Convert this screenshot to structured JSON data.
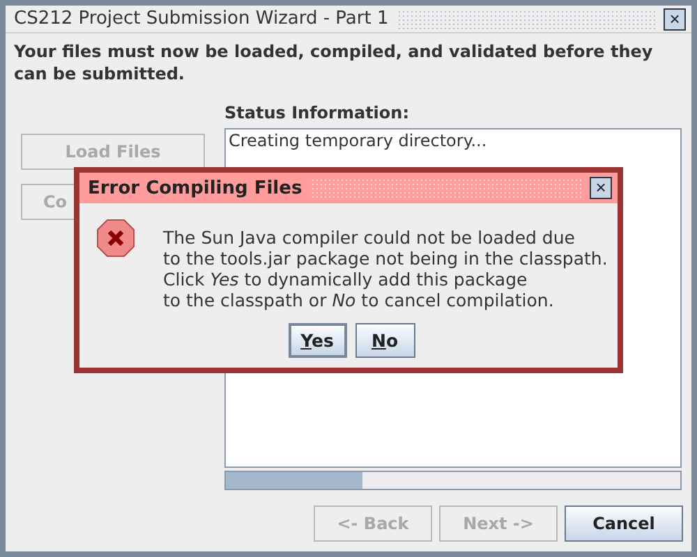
{
  "window": {
    "title": "CS212 Project Submission Wizard - Part 1",
    "close": "×"
  },
  "instructions": "Your files must now be loaded, compiled, and validated before they can be submitted.",
  "actions": [
    {
      "label": "Load Files",
      "disabled": true
    },
    {
      "label": "Co",
      "disabled": true
    }
  ],
  "status": {
    "heading": "Status Information:",
    "lines": [
      "Creating temporary directory..."
    ],
    "progress": {
      "level": 0.3
    }
  },
  "nav_buttons": [
    {
      "label": "<- Back",
      "disabled": true
    },
    {
      "label": "Next ->",
      "disabled": true
    },
    {
      "label": "Cancel",
      "disabled": false
    }
  ],
  "dialog": {
    "title": "Error Compiling Files",
    "message": [
      "The Sun Java compiler could not be loaded due",
      "to the tools.jar package not being in the classpath.",
      "Click *Yes* to dynamically add this package",
      "to the classpath or *No* to cancel compilation."
    ],
    "buttons": [
      {
        "label": "Yes",
        "focused": true
      },
      {
        "label": "No",
        "focused": false
      }
    ]
  }
}
